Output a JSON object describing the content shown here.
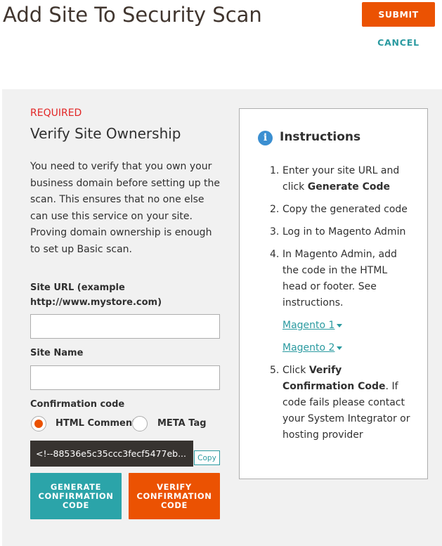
{
  "header": {
    "title": "Add Site To Security Scan",
    "submit_label": "SUBMIT",
    "cancel_label": "CANCEL"
  },
  "form": {
    "required_label": "REQUIRED",
    "section_title": "Verify Site Ownership",
    "intro_text": "You need to verify that you own your business domain before setting up the scan. This ensures that no one else can use this service on your site. Proving domain ownership is enough to set up Basic scan.",
    "site_url_label": "Site URL (example http://www.mystore.com)",
    "site_url_value": "",
    "site_name_label": "Site Name",
    "site_name_value": "",
    "confirmation_label": "Confirmation code",
    "radio_options": [
      {
        "label": "HTML Comment",
        "checked": true
      },
      {
        "label": "META Tag",
        "checked": false
      }
    ],
    "code_value": "<!--88536e5c35ccc3fecf5477eb...",
    "copy_label": "Copy",
    "generate_label": "GENERATE CONFIRMATION CODE",
    "verify_label": "VERIFY CONFIRMATION CODE"
  },
  "instructions": {
    "title": "Instructions",
    "steps": [
      {
        "num": "1.",
        "text": "Enter your site URL and click ",
        "bold": "Generate Code",
        "after": ""
      },
      {
        "num": "2.",
        "text": "Copy the generated code",
        "bold": "",
        "after": ""
      },
      {
        "num": "3.",
        "text": "Log in to Magento Admin",
        "bold": "",
        "after": ""
      },
      {
        "num": "4.",
        "text": "In Magento Admin, add the code in the HTML head or footer. See instructions.",
        "bold": "",
        "after": ""
      },
      {
        "num": "5.",
        "text": "Click ",
        "bold": "Verify Confirmation Code",
        "after": ". If code fails please contact your System Integrator or hosting provider"
      }
    ],
    "links": [
      {
        "label": "Magento 1"
      },
      {
        "label": "Magento 2"
      }
    ]
  },
  "colors": {
    "accent_orange": "#eb5202",
    "accent_teal": "#2ba4a9",
    "required_red": "#e22626",
    "info_blue": "#3b8fd1"
  },
  "icons": {
    "info": "info-icon",
    "caret": "chevron-down-icon"
  }
}
